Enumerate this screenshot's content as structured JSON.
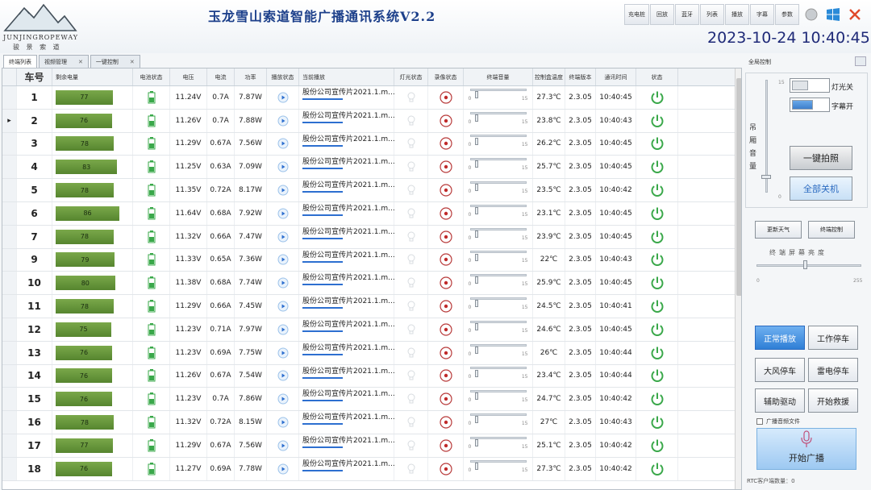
{
  "header": {
    "logo_text": "JUNJINGROPEWAY",
    "logo_sub": "骏 景 索 道",
    "title": "玉龙雪山索道智能广播通讯系统V2.2",
    "datetime": "2023-10-24 10:40:45",
    "toolbar": [
      "充电桩",
      "回放",
      "蓝牙",
      "列表",
      "播放",
      "字幕",
      "参数"
    ],
    "colors": {
      "title": "#1c3f8a",
      "datetime": "#1f2a78",
      "close": "#e04a2a",
      "windows": "#2a8ad8"
    }
  },
  "tabs": [
    {
      "label": "终端列表",
      "closable": false
    },
    {
      "label": "视频管理",
      "closable": true
    },
    {
      "label": "一键控制",
      "closable": true
    }
  ],
  "table": {
    "columns": [
      "",
      "车号",
      "剩余电量",
      "电池状态",
      "电压",
      "电流",
      "功率",
      "播放状态",
      "当前播放",
      "灯光状态",
      "录像状态",
      "终端音量",
      "控制盒温度",
      "终端版本",
      "通讯时间",
      "状态"
    ],
    "volume_min": "0",
    "volume_max": "15",
    "rows": [
      {
        "no": "1",
        "battery": 77,
        "voltage": "11.24V",
        "current": "0.7A",
        "power": "7.87W",
        "playing": "股份公司宣传片2021.1.m...",
        "temp": "27.3℃",
        "version": "2.3.05",
        "time": "10:40:45"
      },
      {
        "no": "2",
        "battery": 76,
        "voltage": "11.26V",
        "current": "0.7A",
        "power": "7.88W",
        "playing": "股份公司宣传片2021.1.m...",
        "temp": "23.8℃",
        "version": "2.3.05",
        "time": "10:40:43"
      },
      {
        "no": "3",
        "battery": 78,
        "voltage": "11.29V",
        "current": "0.67A",
        "power": "7.56W",
        "playing": "股份公司宣传片2021.1.m...",
        "temp": "26.2℃",
        "version": "2.3.05",
        "time": "10:40:45"
      },
      {
        "no": "4",
        "battery": 83,
        "voltage": "11.25V",
        "current": "0.63A",
        "power": "7.09W",
        "playing": "股份公司宣传片2021.1.m...",
        "temp": "25.7℃",
        "version": "2.3.05",
        "time": "10:40:45"
      },
      {
        "no": "5",
        "battery": 78,
        "voltage": "11.35V",
        "current": "0.72A",
        "power": "8.17W",
        "playing": "股份公司宣传片2021.1.m...",
        "temp": "23.5℃",
        "version": "2.3.05",
        "time": "10:40:42"
      },
      {
        "no": "6",
        "battery": 86,
        "voltage": "11.64V",
        "current": "0.68A",
        "power": "7.92W",
        "playing": "股份公司宣传片2021.1.m...",
        "temp": "23.1℃",
        "version": "2.3.05",
        "time": "10:40:45"
      },
      {
        "no": "7",
        "battery": 78,
        "voltage": "11.32V",
        "current": "0.66A",
        "power": "7.47W",
        "playing": "股份公司宣传片2021.1.m...",
        "temp": "23.9℃",
        "version": "2.3.05",
        "time": "10:40:45"
      },
      {
        "no": "9",
        "battery": 79,
        "voltage": "11.33V",
        "current": "0.65A",
        "power": "7.36W",
        "playing": "股份公司宣传片2021.1.m...",
        "temp": "22℃",
        "version": "2.3.05",
        "time": "10:40:43"
      },
      {
        "no": "10",
        "battery": 80,
        "voltage": "11.38V",
        "current": "0.68A",
        "power": "7.74W",
        "playing": "股份公司宣传片2021.1.m...",
        "temp": "25.9℃",
        "version": "2.3.05",
        "time": "10:40:45"
      },
      {
        "no": "11",
        "battery": 78,
        "voltage": "11.29V",
        "current": "0.66A",
        "power": "7.45W",
        "playing": "股份公司宣传片2021.1.m...",
        "temp": "24.5℃",
        "version": "2.3.05",
        "time": "10:40:41"
      },
      {
        "no": "12",
        "battery": 75,
        "voltage": "11.23V",
        "current": "0.71A",
        "power": "7.97W",
        "playing": "股份公司宣传片2021.1.m...",
        "temp": "24.6℃",
        "version": "2.3.05",
        "time": "10:40:45"
      },
      {
        "no": "13",
        "battery": 76,
        "voltage": "11.23V",
        "current": "0.69A",
        "power": "7.75W",
        "playing": "股份公司宣传片2021.1.m...",
        "temp": "26℃",
        "version": "2.3.05",
        "time": "10:40:44"
      },
      {
        "no": "14",
        "battery": 76,
        "voltage": "11.26V",
        "current": "0.67A",
        "power": "7.54W",
        "playing": "股份公司宣传片2021.1.m...",
        "temp": "23.4℃",
        "version": "2.3.05",
        "time": "10:40:44"
      },
      {
        "no": "15",
        "battery": 76,
        "voltage": "11.23V",
        "current": "0.7A",
        "power": "7.86W",
        "playing": "股份公司宣传片2021.1.m...",
        "temp": "24.7℃",
        "version": "2.3.05",
        "time": "10:40:42"
      },
      {
        "no": "16",
        "battery": 78,
        "voltage": "11.32V",
        "current": "0.72A",
        "power": "8.15W",
        "playing": "股份公司宣传片2021.1.m...",
        "temp": "27℃",
        "version": "2.3.05",
        "time": "10:40:43"
      },
      {
        "no": "17",
        "battery": 77,
        "voltage": "11.29V",
        "current": "0.67A",
        "power": "7.56W",
        "playing": "股份公司宣传片2021.1.m...",
        "temp": "25.1℃",
        "version": "2.3.05",
        "time": "10:40:42"
      },
      {
        "no": "18",
        "battery": 76,
        "voltage": "11.27V",
        "current": "0.69A",
        "power": "7.78W",
        "playing": "股份公司宣传片2021.1.m...",
        "temp": "27.3℃",
        "version": "2.3.05",
        "time": "10:40:42"
      }
    ]
  },
  "right_panel": {
    "title": "全局控制",
    "volume_label": "吊厢音量",
    "volume_max": "15",
    "volume_min": "0",
    "light_toggle": "灯光关",
    "subtitle_toggle": "字幕开",
    "photo_button": "一键拍照",
    "shutdown_button": "全部关机",
    "weather_button": "更新天气",
    "terminal_button": "终端控制",
    "brightness_label": "终端屏幕亮度",
    "brightness_min": "0",
    "brightness_max": "255",
    "modes": [
      "正常播放",
      "工作停车",
      "大风停车",
      "雷电停车",
      "辅助驱动",
      "开始救援"
    ],
    "active_mode": "正常播放",
    "audio_file_label": "广播音频文件",
    "broadcast_button": "开始广播",
    "rtc_label": "RTC客户端数量：0",
    "colors": {
      "active": "#2f7fd6",
      "shutdown_text": "#2a6ac0"
    }
  }
}
